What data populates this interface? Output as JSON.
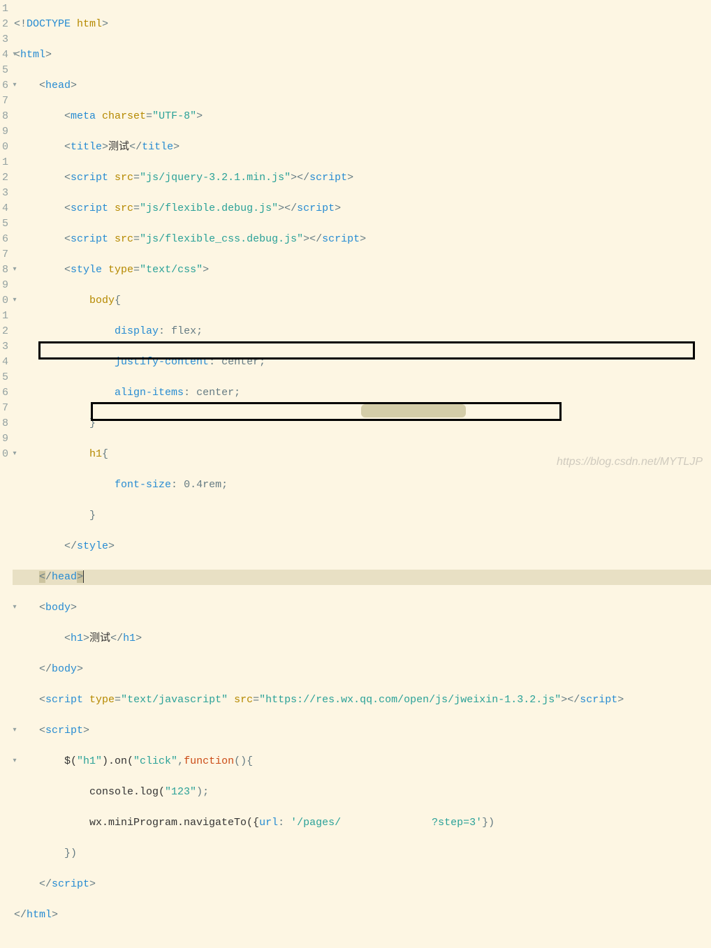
{
  "watermark": "https://blog.csdn.net/MYTLJP",
  "gutter": [
    "1",
    "2",
    "3",
    "4",
    "5",
    "6",
    "7",
    "8",
    "9",
    "0",
    "1",
    "2",
    "3",
    "4",
    "5",
    "6",
    "7",
    "8",
    "9",
    "0",
    "1",
    "2",
    "3",
    "4",
    "5",
    "6",
    "7",
    "8",
    "9",
    "0"
  ],
  "fold": {
    "1": "",
    "2": "▾",
    "3": "▾",
    "4": "",
    "5": "",
    "6": "",
    "7": "",
    "8": "",
    "9": "▾",
    "10": "▾",
    "11": "",
    "12": "",
    "13": "",
    "14": "",
    "15": "▾",
    "16": "",
    "17": "",
    "18": "",
    "19": "",
    "20": "▾",
    "21": "",
    "22": "",
    "23": "",
    "24": "▾",
    "25": "▾",
    "26": "",
    "27": "",
    "28": "",
    "29": "",
    "30": ""
  },
  "code": {
    "l1": {
      "a": "<!",
      "b": "DOCTYPE ",
      "c": "html",
      "d": ">"
    },
    "l2": {
      "a": "<",
      "b": "html",
      "c": ">"
    },
    "l3": {
      "a": "    <",
      "b": "head",
      "c": ">"
    },
    "l4": {
      "a": "        <",
      "b": "meta ",
      "c": "charset",
      "d": "=",
      "e": "\"UTF-8\"",
      "f": ">"
    },
    "l5": {
      "a": "        <",
      "b": "title",
      "c": ">",
      "d": "测试",
      "e": "</",
      "f": "title",
      "g": ">"
    },
    "l6": {
      "a": "        <",
      "b": "script ",
      "c": "src",
      "d": "=",
      "e": "\"js/jquery-3.2.1.min.js\"",
      "f": "></",
      "g": "script",
      "h": ">"
    },
    "l7": {
      "a": "        <",
      "b": "script ",
      "c": "src",
      "d": "=",
      "e": "\"js/flexible.debug.js\"",
      "f": "></",
      "g": "script",
      "h": ">"
    },
    "l8": {
      "a": "        <",
      "b": "script ",
      "c": "src",
      "d": "=",
      "e": "\"js/flexible_css.debug.js\"",
      "f": "></",
      "g": "script",
      "h": ">"
    },
    "l9": {
      "a": "        <",
      "b": "style ",
      "c": "type",
      "d": "=",
      "e": "\"text/css\"",
      "f": ">"
    },
    "l10": {
      "a": "            ",
      "b": "body",
      "c": "{"
    },
    "l11": {
      "a": "                ",
      "b": "display",
      "c": ": ",
      "d": "flex",
      "e": ";"
    },
    "l12": {
      "a": "                ",
      "b": "justify-content",
      "c": ": ",
      "d": "center",
      "e": ";"
    },
    "l13": {
      "a": "                ",
      "b": "align-items",
      "c": ": ",
      "d": "center",
      "e": ";"
    },
    "l14": {
      "a": "            }"
    },
    "l15": {
      "a": "            ",
      "b": "h1",
      "c": "{"
    },
    "l16": {
      "a": "                ",
      "b": "font-size",
      "c": ": ",
      "d": "0.4rem",
      "e": ";"
    },
    "l17": {
      "a": "            }"
    },
    "l18": {
      "a": "        </",
      "b": "style",
      "c": ">"
    },
    "l19": {
      "a": "    ",
      "b": "<",
      "c": "/",
      "d": "head",
      "e": ">"
    },
    "l20": {
      "a": "    <",
      "b": "body",
      "c": ">"
    },
    "l21": {
      "a": "        <",
      "b": "h1",
      "c": ">",
      "d": "测试",
      "e": "</",
      "f": "h1",
      "g": ">"
    },
    "l22": {
      "a": "    </",
      "b": "body",
      "c": ">"
    },
    "l23": {
      "a": "    <",
      "b": "script ",
      "c": "type",
      "d": "=",
      "e": "\"text/javascript\"",
      "f": " ",
      "g": "src",
      "h": "=",
      "i": "\"https://res.wx.qq.com/open/js/jweixin-1.3.2.js\"",
      "j": "></",
      "k": "script",
      "l": ">"
    },
    "l24": {
      "a": "    <",
      "b": "script",
      "c": ">"
    },
    "l25": {
      "a": "        $(",
      "b": "\"h1\"",
      "c": ").on(",
      "d": "\"click\"",
      "e": ",",
      "f": "function",
      "g": "(){"
    },
    "l26": {
      "a": "            console.log(",
      "b": "\"123\"",
      "c": ");"
    },
    "l27": {
      "a": "            wx.miniProgram.navigateTo({",
      "b": "url",
      "c": ": ",
      "d": "'/pages/",
      "e": "?step=3'",
      "f": "})"
    },
    "l28": {
      "a": "        })"
    },
    "l29": {
      "a": "    </",
      "b": "script",
      "c": ">"
    },
    "l30": {
      "a": "</",
      "b": "html",
      "c": ">"
    }
  }
}
